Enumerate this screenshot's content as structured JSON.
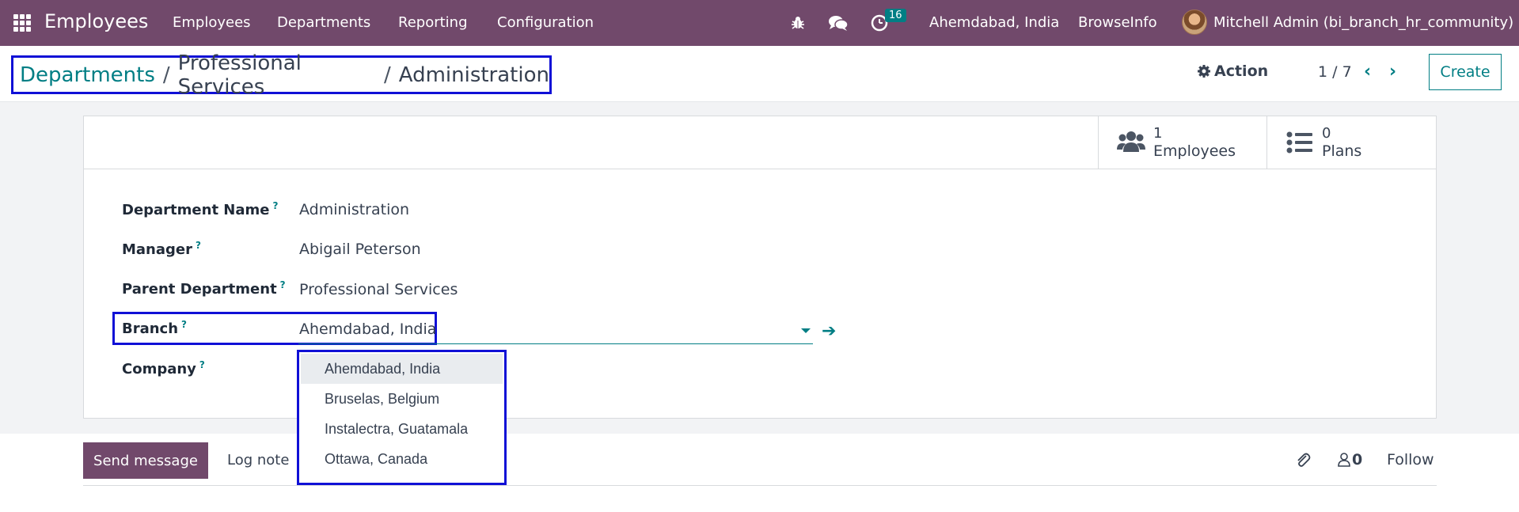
{
  "navbar": {
    "app_name": "Employees",
    "menus": [
      "Employees",
      "Departments",
      "Reporting",
      "Configuration"
    ],
    "activity_count": "16",
    "branch": "Ahemdabad, India",
    "company": "BrowseInfo",
    "user": "Mitchell Admin (bi_branch_hr_community)",
    "bg_color": "#71496b"
  },
  "breadcrumb": {
    "root": "Departments",
    "sep": "/",
    "parent": "Professional Services",
    "current": "Administration"
  },
  "control": {
    "action_label": "Action",
    "pager": "1 / 7",
    "create_label": "Create"
  },
  "stat_buttons": {
    "employees": {
      "count": "1",
      "label": "Employees"
    },
    "plans": {
      "count": "0",
      "label": "Plans"
    }
  },
  "form": {
    "department_name_label": "Department Name",
    "department_name": "Administration",
    "manager_label": "Manager",
    "manager": "Abigail Peterson",
    "parent_label": "Parent Department",
    "parent": "Professional Services",
    "branch_label": "Branch",
    "branch": "Ahemdabad, India",
    "company_label": "Company",
    "help_mark": "?"
  },
  "branch_dropdown": {
    "options": [
      "Ahemdabad, India",
      "Bruselas, Belgium",
      "Instalectra, Guatamala",
      "Ottawa, Canada"
    ],
    "selected_index": 0
  },
  "chatter": {
    "send_label": "Send message",
    "log_label": "Log note",
    "followers_count": "0",
    "follow_label": "Follow"
  },
  "colors": {
    "accent": "#017e84",
    "primary": "#71496b",
    "highlight_box": "#1010d6"
  }
}
